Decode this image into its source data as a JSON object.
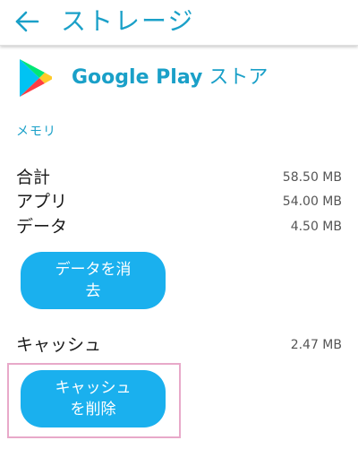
{
  "header": {
    "title": "ストレージ",
    "back_icon": "arrow-left-icon"
  },
  "app": {
    "name": "Google Play",
    "name_suffix": " ストア",
    "logo_icon": "google-play-logo-icon"
  },
  "storage": {
    "section_title": "メモリ",
    "rows": [
      {
        "label": "合計",
        "value": "58.50 MB"
      },
      {
        "label": "アプリ",
        "value": "54.00 MB"
      },
      {
        "label": "データ",
        "value": "4.50 MB"
      }
    ],
    "clear_data_label": "データを消去"
  },
  "cache": {
    "label": "キャッシュ",
    "value": "2.47 MB",
    "clear_cache_label": "キャッシュを削除"
  },
  "colors": {
    "accent": "#1aa0c8",
    "button": "#1ab0ee",
    "highlight": "#e8a9c9"
  }
}
